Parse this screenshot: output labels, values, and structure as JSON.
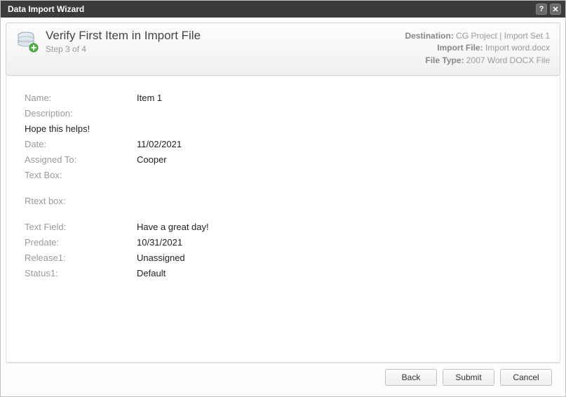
{
  "window": {
    "title": "Data Import Wizard"
  },
  "header": {
    "title": "Verify First Item in Import File",
    "step": "Step 3 of 4",
    "destination_label": "Destination:",
    "destination_value": "CG Project | Import Set 1",
    "import_file_label": "Import File:",
    "import_file_value": "Import word.docx",
    "file_type_label": "File Type:",
    "file_type_value": "2007 Word DOCX File"
  },
  "fields": {
    "name_label": "Name:",
    "name_value": "Item 1",
    "description_label": "Description:",
    "description_value": "Hope this helps!",
    "date_label": "Date:",
    "date_value": "11/02/2021",
    "assigned_to_label": "Assigned To:",
    "assigned_to_value": "Cooper",
    "text_box_label": "Text Box:",
    "text_box_value": "",
    "rtext_box_label": "Rtext box:",
    "rtext_box_value": "",
    "text_field_label": "Text Field:",
    "text_field_value": "Have a great day!",
    "predate_label": "Predate:",
    "predate_value": "10/31/2021",
    "release1_label": "Release1:",
    "release1_value": "Unassigned",
    "status1_label": "Status1:",
    "status1_value": "Default"
  },
  "buttons": {
    "back": "Back",
    "submit": "Submit",
    "cancel": "Cancel"
  },
  "controls": {
    "help": "?",
    "close": "✕"
  }
}
